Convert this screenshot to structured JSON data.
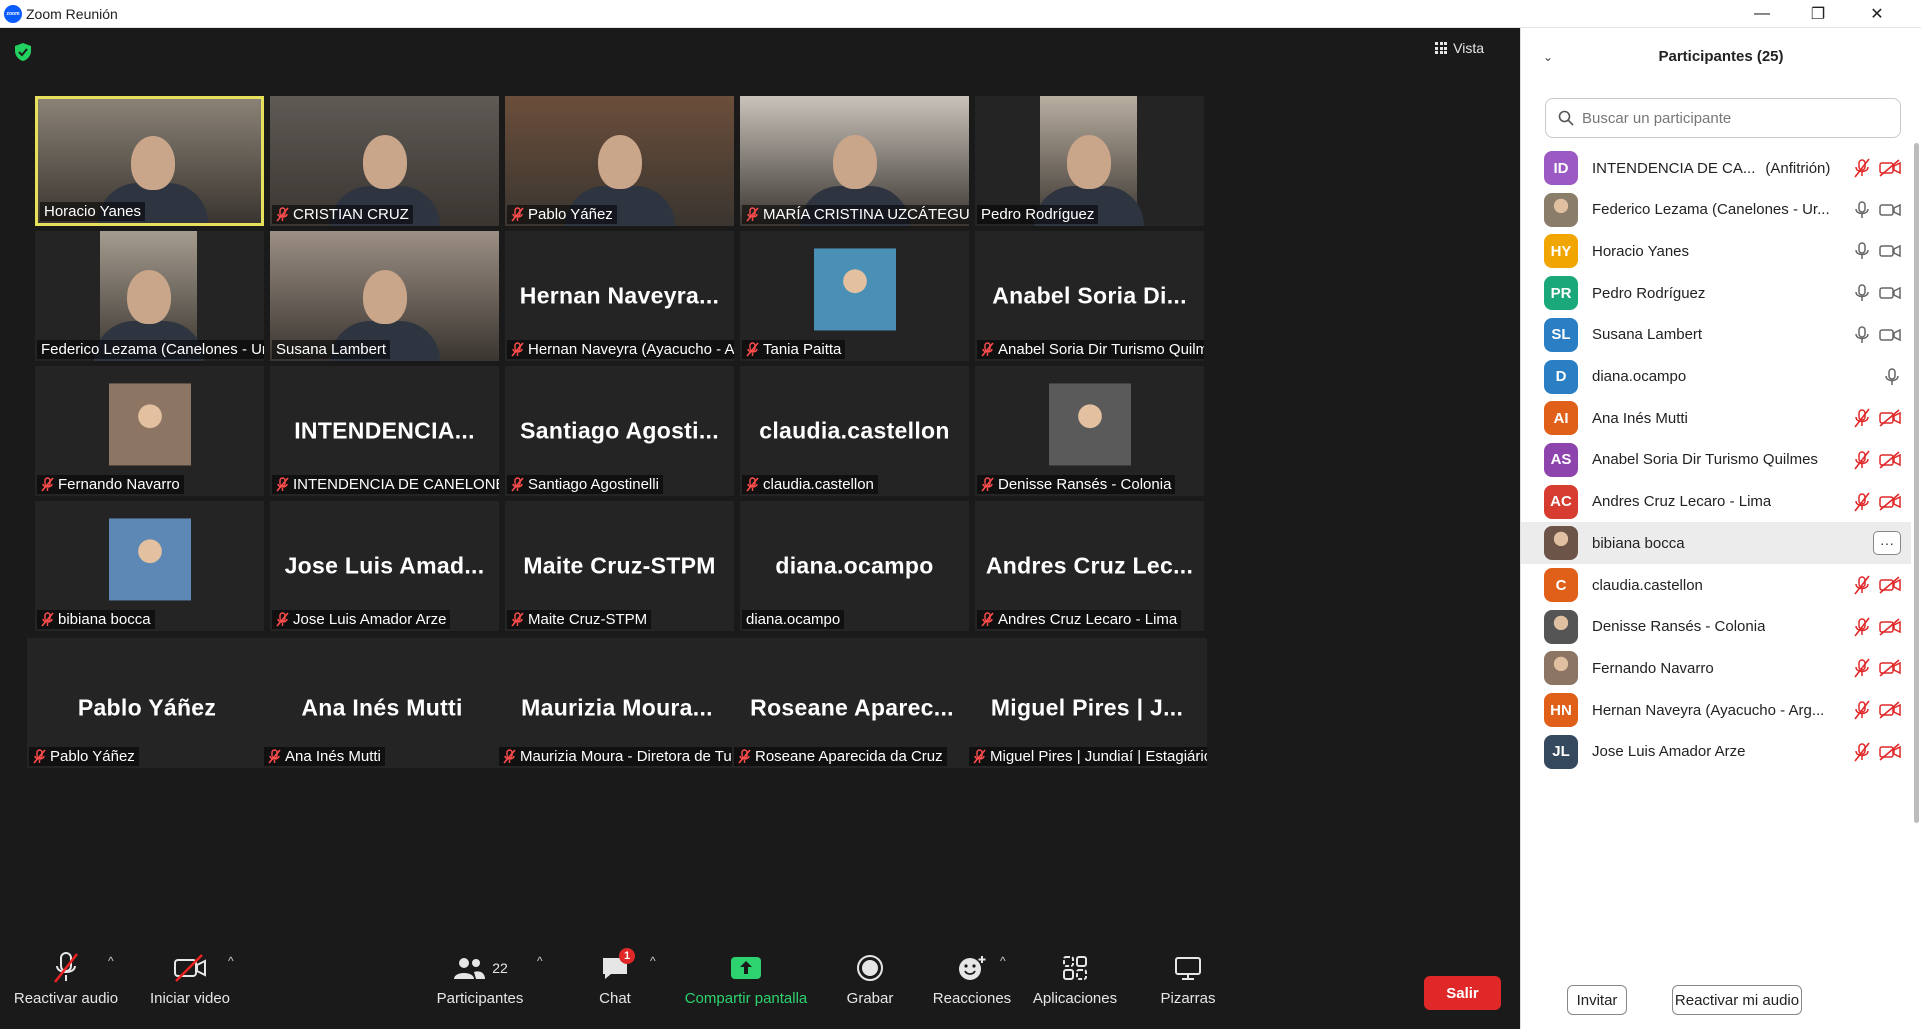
{
  "window": {
    "title": "Zoom Reunión",
    "logo": "zoom"
  },
  "meeting": {
    "view_label": "Vista",
    "tiles": [
      {
        "kind": "video",
        "label": "Horacio Yanes",
        "muted": false,
        "active": true,
        "bg": "#8a8276"
      },
      {
        "kind": "video",
        "label": "CRISTIAN CRUZ",
        "muted": true,
        "bg": "#5e5a55"
      },
      {
        "kind": "video",
        "label": "Pablo Yáñez",
        "muted": true,
        "bg": "#6b4e3a"
      },
      {
        "kind": "video",
        "label": "MARÍA CRISTINA UZCÁTEGUI (Rio...",
        "muted": true,
        "bg": "#c9c3bb"
      },
      {
        "kind": "video",
        "label": "Pedro Rodríguez",
        "muted": false,
        "bg": "#b9aea0"
      },
      {
        "kind": "video",
        "label": "Federico Lezama (Canelones - Urugu...",
        "muted": false,
        "bg": "#a59c8f"
      },
      {
        "kind": "video",
        "label": "Susana Lambert",
        "muted": false,
        "bg": "#9c8f84"
      },
      {
        "kind": "name",
        "big": "Hernan Naveyra...",
        "label": "Hernan Naveyra (Ayacucho - Arge...",
        "muted": true
      },
      {
        "kind": "pic",
        "label": "Tania Paitta",
        "muted": true,
        "bg": "#4a8fb5"
      },
      {
        "kind": "name",
        "big": "Anabel Soria Di...",
        "label": "Anabel Soria Dir Turismo Quilmes",
        "muted": true
      },
      {
        "kind": "pic",
        "label": "Fernando Navarro",
        "muted": true,
        "bg": "#8c7563"
      },
      {
        "kind": "name",
        "big": "INTENDENCIA...",
        "label": "INTENDENCIA DE CANELONES",
        "muted": true
      },
      {
        "kind": "name",
        "big": "Santiago Agosti...",
        "label": "Santiago Agostinelli",
        "muted": true
      },
      {
        "kind": "name",
        "big": "claudia.castellon",
        "label": "claudia.castellon",
        "muted": true
      },
      {
        "kind": "pic",
        "label": "Denisse Ransés - Colonia",
        "muted": true,
        "bg": "#5a5a5a"
      },
      {
        "kind": "pic",
        "label": "bibiana bocca",
        "muted": true,
        "bg": "#5d87b5"
      },
      {
        "kind": "name",
        "big": "Jose Luis Amad...",
        "label": "Jose Luis Amador Arze",
        "muted": true
      },
      {
        "kind": "name",
        "big": "Maite Cruz-STPM",
        "label": "Maite Cruz-STPM",
        "muted": true
      },
      {
        "kind": "name",
        "big": "diana.ocampo",
        "label": "diana.ocampo",
        "muted": false
      },
      {
        "kind": "name",
        "big": "Andres Cruz Lec...",
        "label": "Andres Cruz Lecaro - Lima",
        "muted": true
      },
      {
        "kind": "name",
        "big": "Pablo Yáñez",
        "label": "Pablo Yáñez",
        "muted": true
      },
      {
        "kind": "name",
        "big": "Ana Inés Mutti",
        "label": "Ana Inés Mutti",
        "muted": true
      },
      {
        "kind": "name",
        "big": "Maurizia Moura...",
        "label": "Maurizia Moura - Diretora de Turi...",
        "muted": true
      },
      {
        "kind": "name",
        "big": "Roseane Aparec...",
        "label": "Roseane Aparecida da Cruz",
        "muted": true
      },
      {
        "kind": "name",
        "big": "Miguel Pires | J...",
        "label": "Miguel Pires | Jundiaí | Estagiário",
        "muted": true
      }
    ]
  },
  "toolbar": {
    "audio": "Reactivar audio",
    "video": "Iniciar video",
    "participants": "Participantes",
    "participants_count": "22",
    "chat": "Chat",
    "chat_badge": "1",
    "share": "Compartir pantalla",
    "record": "Grabar",
    "reactions": "Reacciones",
    "apps": "Aplicaciones",
    "whiteboards": "Pizarras",
    "leave": "Salir"
  },
  "panel": {
    "title": "Participantes (25)",
    "search_placeholder": "Buscar un participante",
    "participants": [
      {
        "initials": "ID",
        "color": "#9b59c4",
        "name": "INTENDENCIA DE CA...",
        "role": "(Anfitrión)",
        "mic": "muted",
        "cam": "off"
      },
      {
        "initials": "",
        "color": "#8a7d6a",
        "name": "Federico Lezama (Canelones - Ur...",
        "mic": "on",
        "cam": "on"
      },
      {
        "initials": "HY",
        "color": "#f0a500",
        "name": "Horacio Yanes",
        "mic": "on",
        "cam": "on"
      },
      {
        "initials": "PR",
        "color": "#1aa87a",
        "name": "Pedro Rodríguez",
        "mic": "on",
        "cam": "on"
      },
      {
        "initials": "SL",
        "color": "#2a7fc4",
        "name": "Susana Lambert",
        "mic": "on",
        "cam": "on"
      },
      {
        "initials": "D",
        "color": "#2a7fc4",
        "name": "diana.ocampo",
        "mic": "on",
        "cam": "none"
      },
      {
        "initials": "AI",
        "color": "#e0601a",
        "name": "Ana Inés Mutti",
        "mic": "muted",
        "cam": "off"
      },
      {
        "initials": "AS",
        "color": "#8e44ad",
        "name": "Anabel Soria Dir Turismo Quilmes",
        "mic": "muted",
        "cam": "off"
      },
      {
        "initials": "AC",
        "color": "#d63c2f",
        "name": "Andres Cruz Lecaro - Lima",
        "mic": "muted",
        "cam": "off"
      },
      {
        "initials": "",
        "color": "#6d5448",
        "name": "bibiana bocca",
        "mic": "more",
        "cam": "none",
        "highlight": true
      },
      {
        "initials": "C",
        "color": "#e0601a",
        "name": "claudia.castellon",
        "mic": "muted",
        "cam": "off"
      },
      {
        "initials": "",
        "color": "#555555",
        "name": "Denisse Ransés - Colonia",
        "mic": "muted",
        "cam": "off"
      },
      {
        "initials": "",
        "color": "#8c7563",
        "name": "Fernando Navarro",
        "mic": "muted",
        "cam": "off"
      },
      {
        "initials": "HN",
        "color": "#e0601a",
        "name": "Hernan Naveyra (Ayacucho - Arg...",
        "mic": "muted",
        "cam": "off"
      },
      {
        "initials": "JL",
        "color": "#34495e",
        "name": "Jose Luis Amador Arze",
        "mic": "muted",
        "cam": "off"
      }
    ],
    "invite": "Invitar",
    "unmute_me": "Reactivar mi audio"
  }
}
